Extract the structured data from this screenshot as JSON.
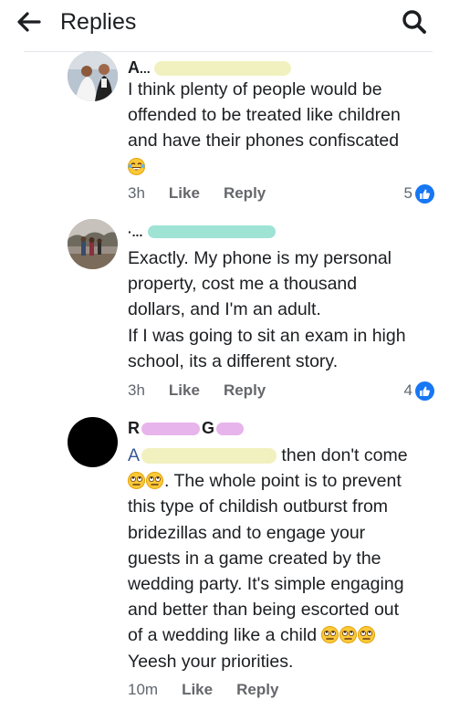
{
  "header": {
    "title": "Replies",
    "back_icon": "arrow-left-icon",
    "search_icon": "search-icon"
  },
  "comments": [
    {
      "author": "A",
      "author_visible_fragment": "A...",
      "text_lines": [
        "I think plenty of people would be",
        "offended to be treated like children",
        "and have their phones confiscated"
      ],
      "emoji": "laughing-tears-emoji",
      "time": "3h",
      "like_label": "Like",
      "reply_label": "Reply",
      "reaction_count": "5",
      "reaction_icon": "like-thumb-icon"
    },
    {
      "author": "",
      "text_lines": [
        "Exactly. My phone is my personal",
        "property, cost me a thousand",
        "dollars, and I'm an adult.",
        "If I was going to sit an exam in high",
        "school, its a different story."
      ],
      "time": "3h",
      "like_label": "Like",
      "reply_label": "Reply",
      "reaction_count": "4",
      "reaction_icon": "like-thumb-icon"
    },
    {
      "author_first": "R",
      "author_second": "G",
      "mention_fragment": "A",
      "text_after_mention": " then don't come",
      "text_line_2": ". The whole point is to prevent",
      "text_lines": [
        "this type of childish outburst from",
        "bridezillas and to engage your",
        "guests in a game created by the",
        "wedding party. It's simple engaging",
        "and better than being escorted out"
      ],
      "text_line_8": "of a wedding like a child",
      "text_line_9": "Yeesh your priorities.",
      "emoji": "eye-roll-emoji",
      "time": "10m",
      "like_label": "Like",
      "reply_label": "Reply"
    }
  ],
  "colors": {
    "text": "#1c1e21",
    "meta": "#606770",
    "mention": "#385898",
    "like_blue": "#1877f2",
    "blur_mint": "#9fe3d5",
    "blur_yellow": "#f1f1c0",
    "blur_pink": "#e8b4ec"
  }
}
